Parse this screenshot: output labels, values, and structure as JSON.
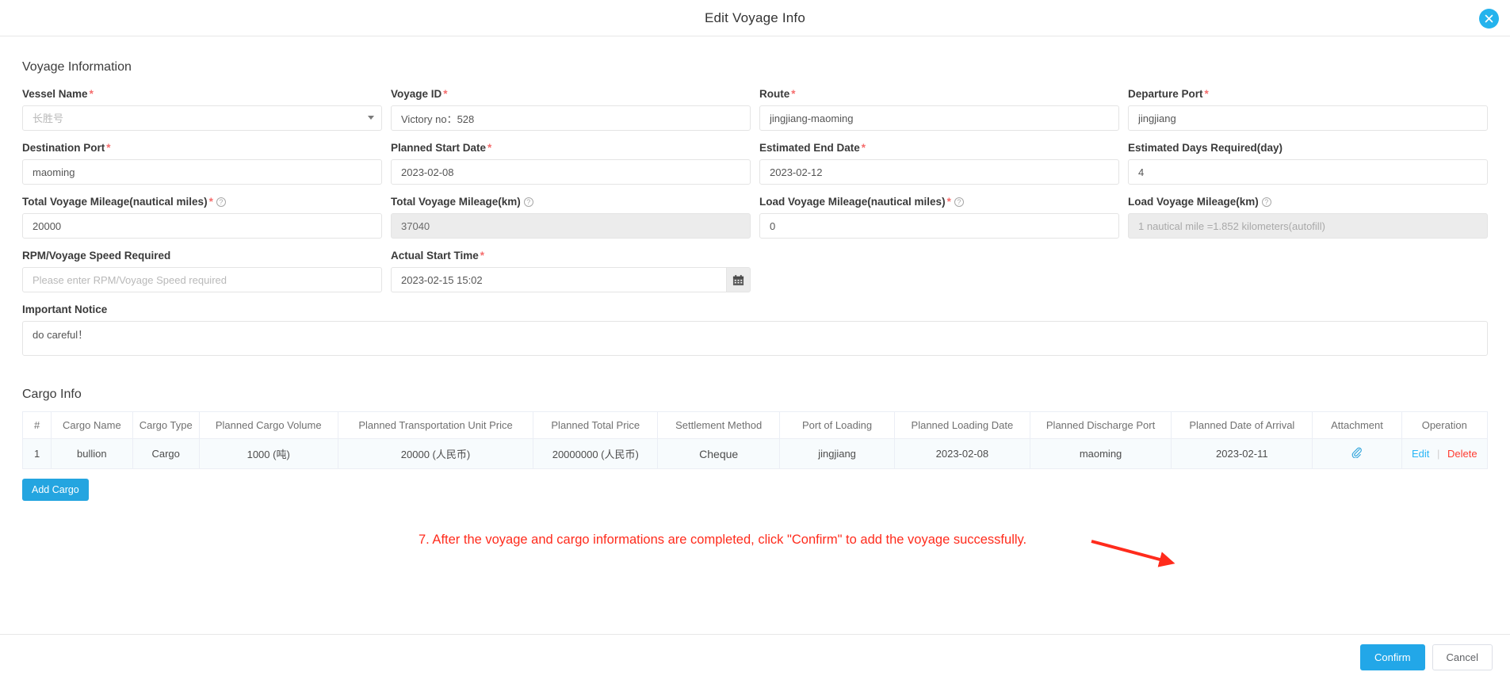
{
  "dialog": {
    "title": "Edit Voyage Info",
    "close_icon": "close-icon"
  },
  "voyage_section": {
    "heading": "Voyage Information",
    "fields": [
      {
        "label": "Vessel Name",
        "required": true,
        "type": "select",
        "value": "长胜号",
        "placeholder": "长胜号",
        "help": false,
        "disabled": false
      },
      {
        "label": "Voyage ID",
        "required": true,
        "type": "text",
        "value": "Victory no：528",
        "placeholder": "",
        "help": false,
        "disabled": false
      },
      {
        "label": "Route",
        "required": true,
        "type": "text",
        "value": "jingjiang-maoming",
        "placeholder": "",
        "help": false,
        "disabled": false
      },
      {
        "label": "Departure Port",
        "required": true,
        "type": "text",
        "value": "jingjiang",
        "placeholder": "",
        "help": false,
        "disabled": false
      },
      {
        "label": "Destination Port",
        "required": true,
        "type": "text",
        "value": "maoming",
        "placeholder": "",
        "help": false,
        "disabled": false
      },
      {
        "label": "Planned Start Date",
        "required": true,
        "type": "text",
        "value": "2023-02-08",
        "placeholder": "",
        "help": false,
        "disabled": false
      },
      {
        "label": "Estimated End Date",
        "required": true,
        "type": "text",
        "value": "2023-02-12",
        "placeholder": "",
        "help": false,
        "disabled": false
      },
      {
        "label": "Estimated Days Required(day)",
        "required": false,
        "type": "text",
        "value": "4",
        "placeholder": "",
        "help": false,
        "disabled": false
      },
      {
        "label": "Total Voyage Mileage(nautical miles)",
        "required": true,
        "type": "text",
        "value": "20000",
        "placeholder": "",
        "help": true,
        "disabled": false
      },
      {
        "label": "Total Voyage Mileage(km)",
        "required": false,
        "type": "text",
        "value": "37040",
        "placeholder": "",
        "help": true,
        "disabled": true
      },
      {
        "label": "Load Voyage Mileage(nautical miles)",
        "required": true,
        "type": "text",
        "value": "0",
        "placeholder": "",
        "help": true,
        "disabled": false
      },
      {
        "label": "Load Voyage Mileage(km)",
        "required": false,
        "type": "text",
        "value": "",
        "placeholder": "1 nautical mile =1.852 kilometers(autofill)",
        "help": true,
        "disabled": true
      },
      {
        "label": "RPM/Voyage Speed Required",
        "required": false,
        "type": "text",
        "value": "",
        "placeholder": "Please enter RPM/Voyage Speed required",
        "help": false,
        "disabled": false
      },
      {
        "label": "Actual Start Time",
        "required": true,
        "type": "datetime",
        "value": "2023-02-15 15:02",
        "placeholder": "",
        "help": false,
        "disabled": false,
        "addon_icon": "calendar-icon"
      }
    ],
    "notice": {
      "label": "Important Notice",
      "value": "do careful！",
      "placeholder": ""
    }
  },
  "cargo_section": {
    "heading": "Cargo Info",
    "columns": [
      "#",
      "Cargo Name",
      "Cargo Type",
      "Planned Cargo Volume",
      "Planned Transportation Unit Price",
      "Planned Total Price",
      "Settlement Method",
      "Port of Loading",
      "Planned Loading Date",
      "Planned Discharge Port",
      "Planned Date of Arrival",
      "Attachment",
      "Operation"
    ],
    "rows": [
      {
        "index": "1",
        "cargo_name": "bullion",
        "cargo_type": "Cargo",
        "planned_cargo_volume": "1000 (吨)",
        "planned_unit_price": "20000 (人民币)",
        "planned_total_price": "20000000 (人民币)",
        "settlement_method": "Cheque",
        "port_of_loading": "jingjiang",
        "planned_loading_date": "2023-02-08",
        "planned_discharge_port": "maoming",
        "planned_date_of_arrival": "2023-02-11",
        "attachment_icon": "paperclip-icon",
        "op_edit": "Edit",
        "op_delete": "Delete"
      }
    ],
    "add_button": "Add Cargo"
  },
  "footer": {
    "confirm": "Confirm",
    "cancel": "Cancel"
  },
  "annotation": {
    "text": "7. After the voyage and cargo informations are completed, click \"Confirm\" to add the voyage successfully.",
    "color": "#ff2b1c"
  }
}
